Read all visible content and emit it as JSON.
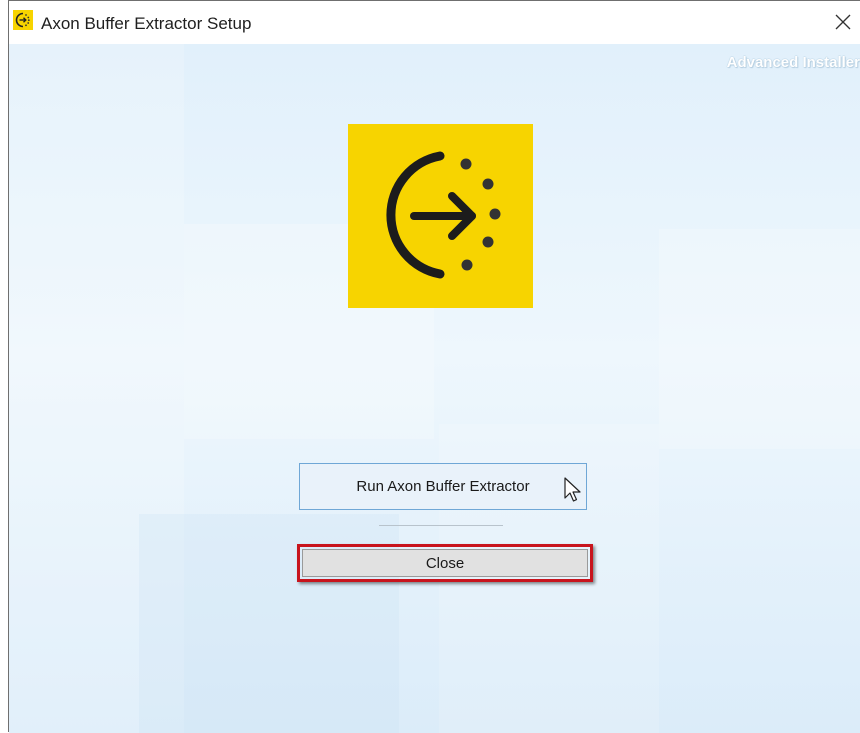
{
  "window": {
    "title": "Axon Buffer Extractor Setup",
    "brand": "Advanced Installer"
  },
  "main": {
    "run_button_label": "Run Axon Buffer Extractor",
    "close_button_label": "Close"
  },
  "colors": {
    "logo_yellow": "#f7d400",
    "highlight_red": "#c8141d",
    "run_button_border": "#6fa7d6"
  },
  "icons": {
    "title_icon": "app-logo-icon",
    "close": "close-icon",
    "logo": "exit-arrow-logo-icon",
    "cursor": "mouse-pointer-icon"
  }
}
